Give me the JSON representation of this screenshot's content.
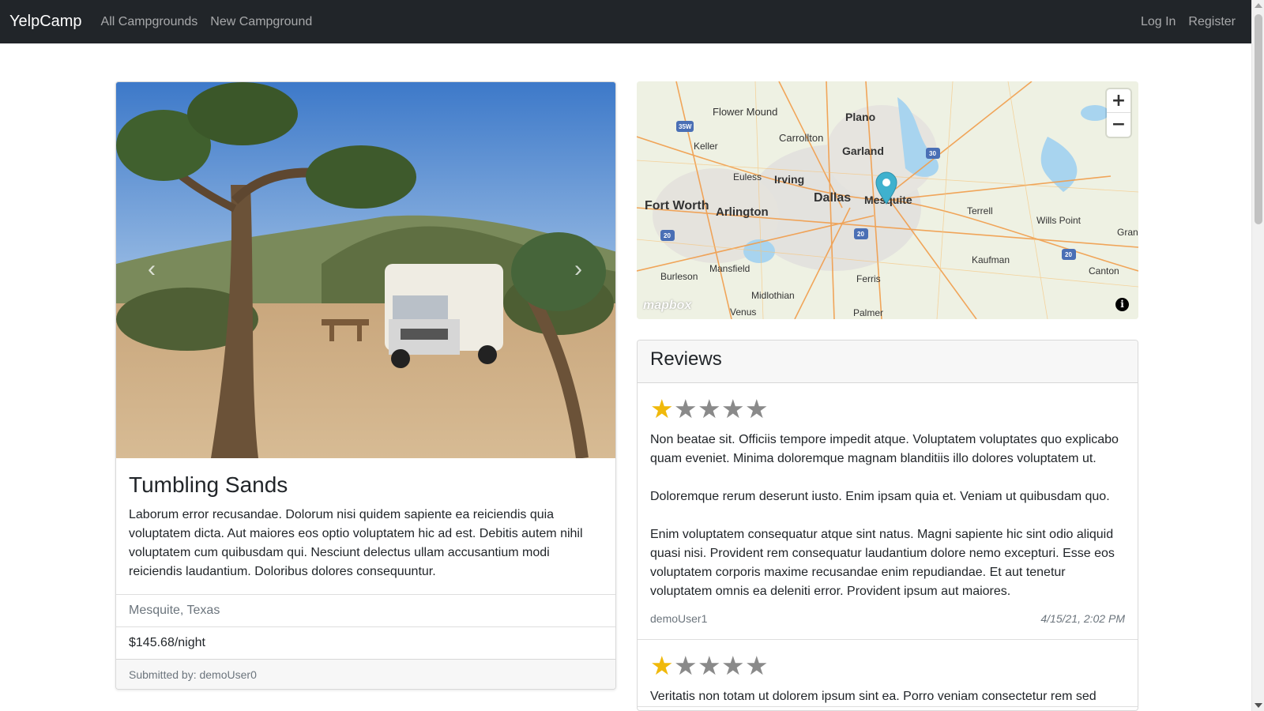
{
  "navbar": {
    "brand": "YelpCamp",
    "links_left": [
      "All Campgrounds",
      "New Campground"
    ],
    "links_right": [
      "Log In",
      "Register"
    ]
  },
  "campground": {
    "title": "Tumbling Sands",
    "description": "Laborum error recusandae. Dolorum nisi quidem sapiente ea reiciendis quia voluptatem dicta. Aut maiores eos optio voluptatem hic ad est. Debitis autem nihil voluptatem cum quibusdam qui. Nesciunt delectus ullam accusantium modi reiciendis laudantium. Doloribus dolores consequuntur.",
    "location": "Mesquite, Texas",
    "price": "$145.68/night",
    "submitted_by": "Submitted by: demoUser0",
    "carousel": {
      "prev_icon": "chevron-left-icon",
      "next_icon": "chevron-right-icon"
    }
  },
  "map": {
    "labels": [
      "Flower Mound",
      "Plano",
      "Keller",
      "Carrollton",
      "Garland",
      "Euless",
      "Irving",
      "Dallas",
      "Mesquite",
      "Fort Worth",
      "Arlington",
      "Terrell",
      "Wills Point",
      "Gran",
      "Kaufman",
      "Mansfield",
      "Burleson",
      "Ferris",
      "Canton",
      "Midlothian",
      "Venus",
      "Palmer"
    ],
    "highways": [
      "35W",
      "30",
      "20",
      "20",
      "20"
    ],
    "zoom_in": "+",
    "zoom_out": "−",
    "attribution": "mapbox",
    "info": "i"
  },
  "reviews": {
    "heading": "Reviews",
    "items": [
      {
        "rating": 1,
        "paragraphs": [
          "Non beatae sit. Officiis tempore impedit atque. Voluptatem voluptates quo explicabo quam eveniet. Minima doloremque magnam blanditiis illo dolores voluptatem ut.",
          "Doloremque rerum deserunt iusto. Enim ipsam quia et. Veniam ut quibusdam quo.",
          "Enim voluptatem consequatur atque sint natus. Magni sapiente hic sint odio aliquid quasi nisi. Provident rem consequatur laudantium dolore nemo excepturi. Esse eos voluptatem corporis maxime recusandae enim repudiandae. Et aut tenetur voluptatem omnis ea deleniti error. Provident ipsum aut maiores."
        ],
        "author": "demoUser1",
        "date": "4/15/21, 2:02 PM"
      },
      {
        "rating": 1,
        "paragraphs": [
          "Veritatis non totam ut dolorem ipsum sint ea. Porro veniam consectetur rem sed"
        ],
        "author": "",
        "date": ""
      }
    ]
  },
  "colors": {
    "navbar": "#212529",
    "star_filled": "#f0b90b",
    "star_empty": "#8a8a8a",
    "map_pin": "#3fb1ce"
  }
}
